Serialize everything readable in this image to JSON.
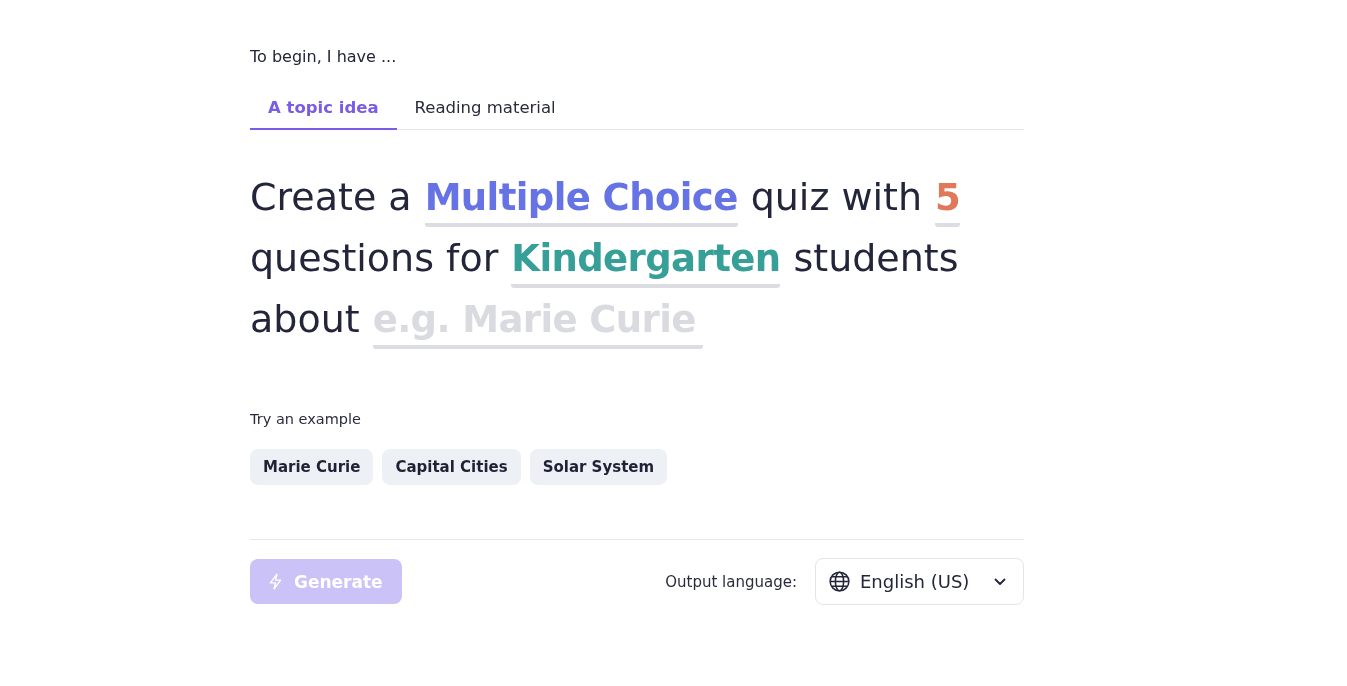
{
  "intro": {
    "text": "To begin, I have ..."
  },
  "tabs": [
    {
      "label": "A topic idea",
      "selected": true
    },
    {
      "label": "Reading material",
      "selected": false
    }
  ],
  "prompt": {
    "lines": [
      [
        {
          "kind": "text",
          "text": "Create a"
        },
        {
          "kind": "choice",
          "value": "Multiple Choice",
          "color": "#6673e4"
        },
        {
          "kind": "text",
          "text": "quiz with"
        },
        {
          "kind": "choice",
          "value": "5",
          "color": "#e2785a"
        }
      ],
      [
        {
          "kind": "text",
          "text": "questions for"
        },
        {
          "kind": "choice",
          "value": "Kindergarten",
          "color": "#359f98"
        },
        {
          "kind": "text",
          "text": "students"
        }
      ],
      [
        {
          "kind": "text",
          "text": "about"
        },
        {
          "kind": "input",
          "placeholder": "e.g. Marie Curie"
        }
      ]
    ]
  },
  "examples": {
    "label": "Try an example",
    "items": [
      "Marie Curie",
      "Capital Cities",
      "Solar System"
    ]
  },
  "footer": {
    "generate": {
      "label": "Generate",
      "disabled": true
    },
    "language": {
      "label": "Output language:",
      "value": "English (US)"
    }
  }
}
